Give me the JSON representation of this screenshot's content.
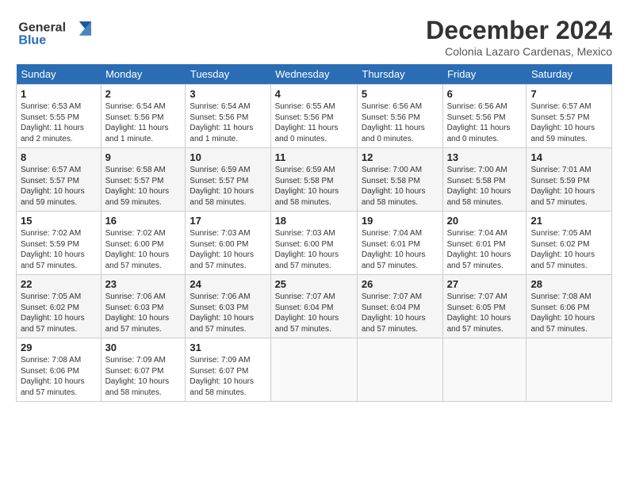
{
  "header": {
    "logo_line1": "General",
    "logo_line2": "Blue",
    "month": "December 2024",
    "location": "Colonia Lazaro Cardenas, Mexico"
  },
  "weekdays": [
    "Sunday",
    "Monday",
    "Tuesday",
    "Wednesday",
    "Thursday",
    "Friday",
    "Saturday"
  ],
  "weeks": [
    [
      {
        "day": "1",
        "sunrise": "6:53 AM",
        "sunset": "5:55 PM",
        "daylight": "11 hours and 2 minutes."
      },
      {
        "day": "2",
        "sunrise": "6:54 AM",
        "sunset": "5:56 PM",
        "daylight": "11 hours and 1 minute."
      },
      {
        "day": "3",
        "sunrise": "6:54 AM",
        "sunset": "5:56 PM",
        "daylight": "11 hours and 1 minute."
      },
      {
        "day": "4",
        "sunrise": "6:55 AM",
        "sunset": "5:56 PM",
        "daylight": "11 hours and 0 minutes."
      },
      {
        "day": "5",
        "sunrise": "6:56 AM",
        "sunset": "5:56 PM",
        "daylight": "11 hours and 0 minutes."
      },
      {
        "day": "6",
        "sunrise": "6:56 AM",
        "sunset": "5:56 PM",
        "daylight": "11 hours and 0 minutes."
      },
      {
        "day": "7",
        "sunrise": "6:57 AM",
        "sunset": "5:57 PM",
        "daylight": "10 hours and 59 minutes."
      }
    ],
    [
      {
        "day": "8",
        "sunrise": "6:57 AM",
        "sunset": "5:57 PM",
        "daylight": "10 hours and 59 minutes."
      },
      {
        "day": "9",
        "sunrise": "6:58 AM",
        "sunset": "5:57 PM",
        "daylight": "10 hours and 59 minutes."
      },
      {
        "day": "10",
        "sunrise": "6:59 AM",
        "sunset": "5:57 PM",
        "daylight": "10 hours and 58 minutes."
      },
      {
        "day": "11",
        "sunrise": "6:59 AM",
        "sunset": "5:58 PM",
        "daylight": "10 hours and 58 minutes."
      },
      {
        "day": "12",
        "sunrise": "7:00 AM",
        "sunset": "5:58 PM",
        "daylight": "10 hours and 58 minutes."
      },
      {
        "day": "13",
        "sunrise": "7:00 AM",
        "sunset": "5:58 PM",
        "daylight": "10 hours and 58 minutes."
      },
      {
        "day": "14",
        "sunrise": "7:01 AM",
        "sunset": "5:59 PM",
        "daylight": "10 hours and 57 minutes."
      }
    ],
    [
      {
        "day": "15",
        "sunrise": "7:02 AM",
        "sunset": "5:59 PM",
        "daylight": "10 hours and 57 minutes."
      },
      {
        "day": "16",
        "sunrise": "7:02 AM",
        "sunset": "6:00 PM",
        "daylight": "10 hours and 57 minutes."
      },
      {
        "day": "17",
        "sunrise": "7:03 AM",
        "sunset": "6:00 PM",
        "daylight": "10 hours and 57 minutes."
      },
      {
        "day": "18",
        "sunrise": "7:03 AM",
        "sunset": "6:00 PM",
        "daylight": "10 hours and 57 minutes."
      },
      {
        "day": "19",
        "sunrise": "7:04 AM",
        "sunset": "6:01 PM",
        "daylight": "10 hours and 57 minutes."
      },
      {
        "day": "20",
        "sunrise": "7:04 AM",
        "sunset": "6:01 PM",
        "daylight": "10 hours and 57 minutes."
      },
      {
        "day": "21",
        "sunrise": "7:05 AM",
        "sunset": "6:02 PM",
        "daylight": "10 hours and 57 minutes."
      }
    ],
    [
      {
        "day": "22",
        "sunrise": "7:05 AM",
        "sunset": "6:02 PM",
        "daylight": "10 hours and 57 minutes."
      },
      {
        "day": "23",
        "sunrise": "7:06 AM",
        "sunset": "6:03 PM",
        "daylight": "10 hours and 57 minutes."
      },
      {
        "day": "24",
        "sunrise": "7:06 AM",
        "sunset": "6:03 PM",
        "daylight": "10 hours and 57 minutes."
      },
      {
        "day": "25",
        "sunrise": "7:07 AM",
        "sunset": "6:04 PM",
        "daylight": "10 hours and 57 minutes."
      },
      {
        "day": "26",
        "sunrise": "7:07 AM",
        "sunset": "6:04 PM",
        "daylight": "10 hours and 57 minutes."
      },
      {
        "day": "27",
        "sunrise": "7:07 AM",
        "sunset": "6:05 PM",
        "daylight": "10 hours and 57 minutes."
      },
      {
        "day": "28",
        "sunrise": "7:08 AM",
        "sunset": "6:06 PM",
        "daylight": "10 hours and 57 minutes."
      }
    ],
    [
      {
        "day": "29",
        "sunrise": "7:08 AM",
        "sunset": "6:06 PM",
        "daylight": "10 hours and 57 minutes."
      },
      {
        "day": "30",
        "sunrise": "7:09 AM",
        "sunset": "6:07 PM",
        "daylight": "10 hours and 58 minutes."
      },
      {
        "day": "31",
        "sunrise": "7:09 AM",
        "sunset": "6:07 PM",
        "daylight": "10 hours and 58 minutes."
      },
      null,
      null,
      null,
      null
    ]
  ],
  "labels": {
    "sunrise": "Sunrise:",
    "sunset": "Sunset:",
    "daylight": "Daylight:"
  }
}
